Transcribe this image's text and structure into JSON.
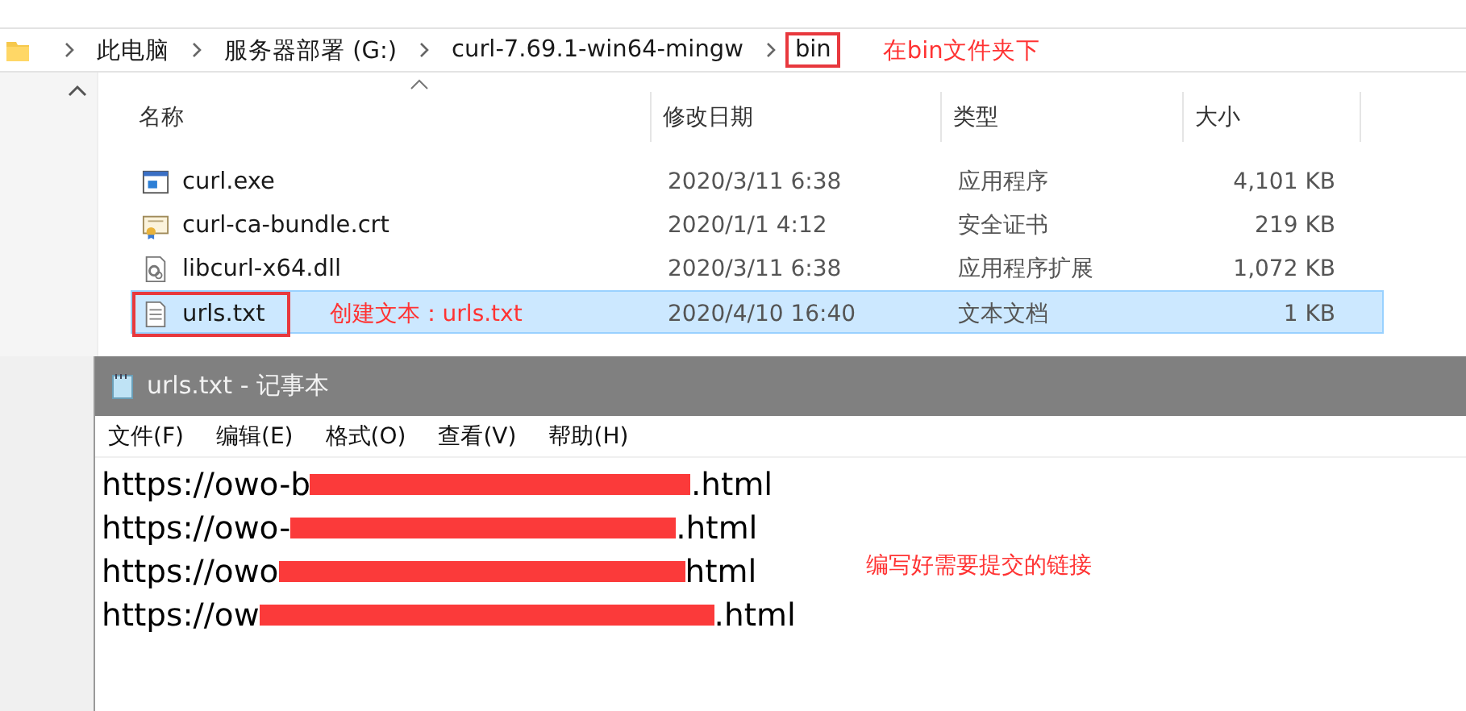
{
  "breadcrumb": {
    "items": [
      {
        "label": "此电脑",
        "framed": false
      },
      {
        "label": "服务器部署 (G:)",
        "framed": false
      },
      {
        "label": "curl-7.69.1-win64-mingw",
        "framed": false
      },
      {
        "label": "bin",
        "framed": true
      }
    ],
    "note": "在bin文件夹下"
  },
  "file_list": {
    "columns": [
      "名称",
      "修改日期",
      "类型",
      "大小"
    ],
    "rows": [
      {
        "kind": "exe",
        "name": "curl.exe",
        "date": "2020/3/11 6:38",
        "type": "应用程序",
        "size": "4,101 KB",
        "selected": false
      },
      {
        "kind": "crt",
        "name": "curl-ca-bundle.crt",
        "date": "2020/1/1 4:12",
        "type": "安全证书",
        "size": "219 KB",
        "selected": false
      },
      {
        "kind": "dll",
        "name": "libcurl-x64.dll",
        "date": "2020/3/11 6:38",
        "type": "应用程序扩展",
        "size": "1,072 KB",
        "selected": false
      },
      {
        "kind": "txt",
        "name": "urls.txt",
        "date": "2020/4/10 16:40",
        "type": "文本文档",
        "size": "1 KB",
        "selected": true,
        "note": "创建文本：urls.txt"
      }
    ]
  },
  "notepad": {
    "title": "urls.txt - 记事本",
    "menu": [
      "文件(F)",
      "编辑(E)",
      "格式(O)",
      "查看(V)",
      "帮助(H)"
    ],
    "lines": [
      {
        "prefix": "https://owo-b",
        "suffix": ".html"
      },
      {
        "prefix": "https://owo-",
        "suffix": ".html"
      },
      {
        "prefix": "https://owo",
        "suffix": "html"
      },
      {
        "prefix": "https://ow",
        "suffix": ".html"
      }
    ],
    "note": "编写好需要提交的链接"
  }
}
